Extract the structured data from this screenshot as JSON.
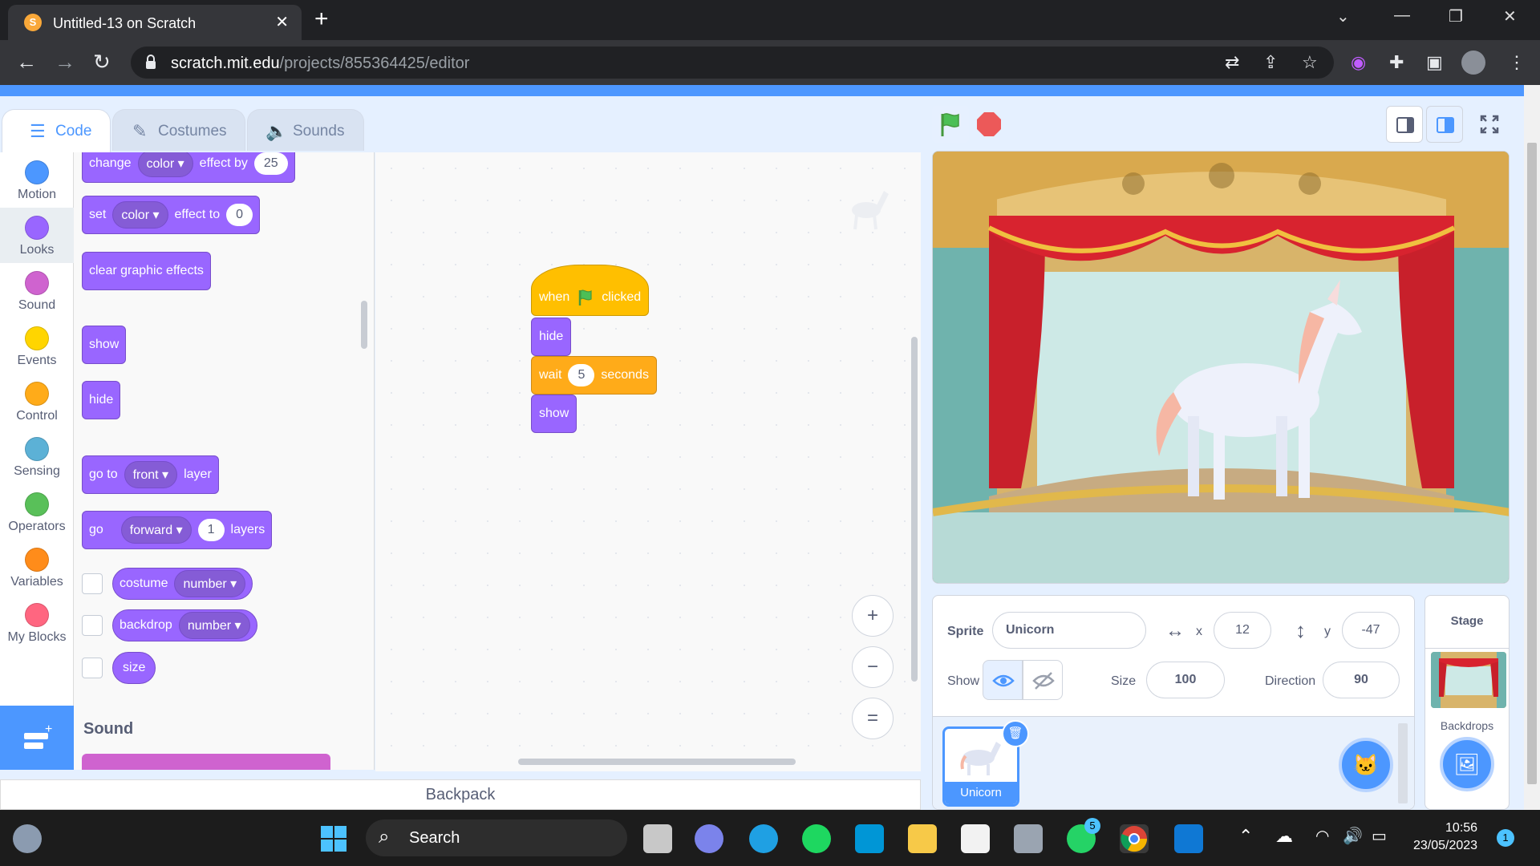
{
  "browser": {
    "tab_title": "Untitled-13 on Scratch",
    "tab_close": "✕",
    "new_tab": "+",
    "url_host": "scratch.mit.edu",
    "url_path": "/projects/855364425/editor"
  },
  "editor_tabs": [
    {
      "label": "Code",
      "icon": "code-icon",
      "active": true
    },
    {
      "label": "Costumes",
      "icon": "brush-icon",
      "active": false
    },
    {
      "label": "Sounds",
      "icon": "speaker-icon",
      "active": false
    }
  ],
  "categories": [
    {
      "label": "Motion",
      "color": "#4c97ff"
    },
    {
      "label": "Looks",
      "color": "#9966ff"
    },
    {
      "label": "Sound",
      "color": "#cf63cf"
    },
    {
      "label": "Events",
      "color": "#ffd500"
    },
    {
      "label": "Control",
      "color": "#ffab19"
    },
    {
      "label": "Sensing",
      "color": "#5cb1d6"
    },
    {
      "label": "Operators",
      "color": "#59c059"
    },
    {
      "label": "Variables",
      "color": "#ff8c1a"
    },
    {
      "label": "My Blocks",
      "color": "#ff6680"
    }
  ],
  "selected_category": "Looks",
  "palette": {
    "change_effect": {
      "word": "change",
      "dropdown": "color",
      "mid": "effect by",
      "value": "25"
    },
    "set_effect": {
      "word": "set",
      "dropdown": "color",
      "mid": "effect to",
      "value": "0"
    },
    "clear_effects": "clear graphic effects",
    "show": "show",
    "hide": "hide",
    "goto_layer": {
      "word": "go to",
      "dropdown": "front",
      "tail": "layer"
    },
    "go_layers": {
      "word": "go",
      "dropdown": "forward",
      "value": "1",
      "tail": "layers"
    },
    "costume_reporter": {
      "word": "costume",
      "dropdown": "number"
    },
    "backdrop_reporter": {
      "word": "backdrop",
      "dropdown": "number"
    },
    "size_reporter": "size",
    "sound_section": "Sound"
  },
  "script": {
    "hat_when": "when",
    "hat_clicked": "clicked",
    "hide": "hide",
    "wait": "wait",
    "wait_value": "5",
    "wait_unit": "seconds",
    "show": "show"
  },
  "zoom_controls": {
    "zoom_in": "+",
    "zoom_out": "−",
    "reset": "="
  },
  "backpack": "Backpack",
  "sprite_info": {
    "sprite_label": "Sprite",
    "sprite_name": "Unicorn",
    "x_label": "x",
    "x_value": "12",
    "y_label": "y",
    "y_value": "-47",
    "show_label": "Show",
    "size_label": "Size",
    "size_value": "100",
    "direction_label": "Direction",
    "direction_value": "90"
  },
  "sprites": [
    {
      "name": "Unicorn",
      "selected": true
    }
  ],
  "stage_panel": {
    "title": "Stage",
    "backdrops_label": "Backdrops"
  },
  "taskbar": {
    "search_label": "Search",
    "whatsapp_badge": "5",
    "time": "10:56",
    "date": "23/05/2023",
    "notification_count": "1"
  }
}
